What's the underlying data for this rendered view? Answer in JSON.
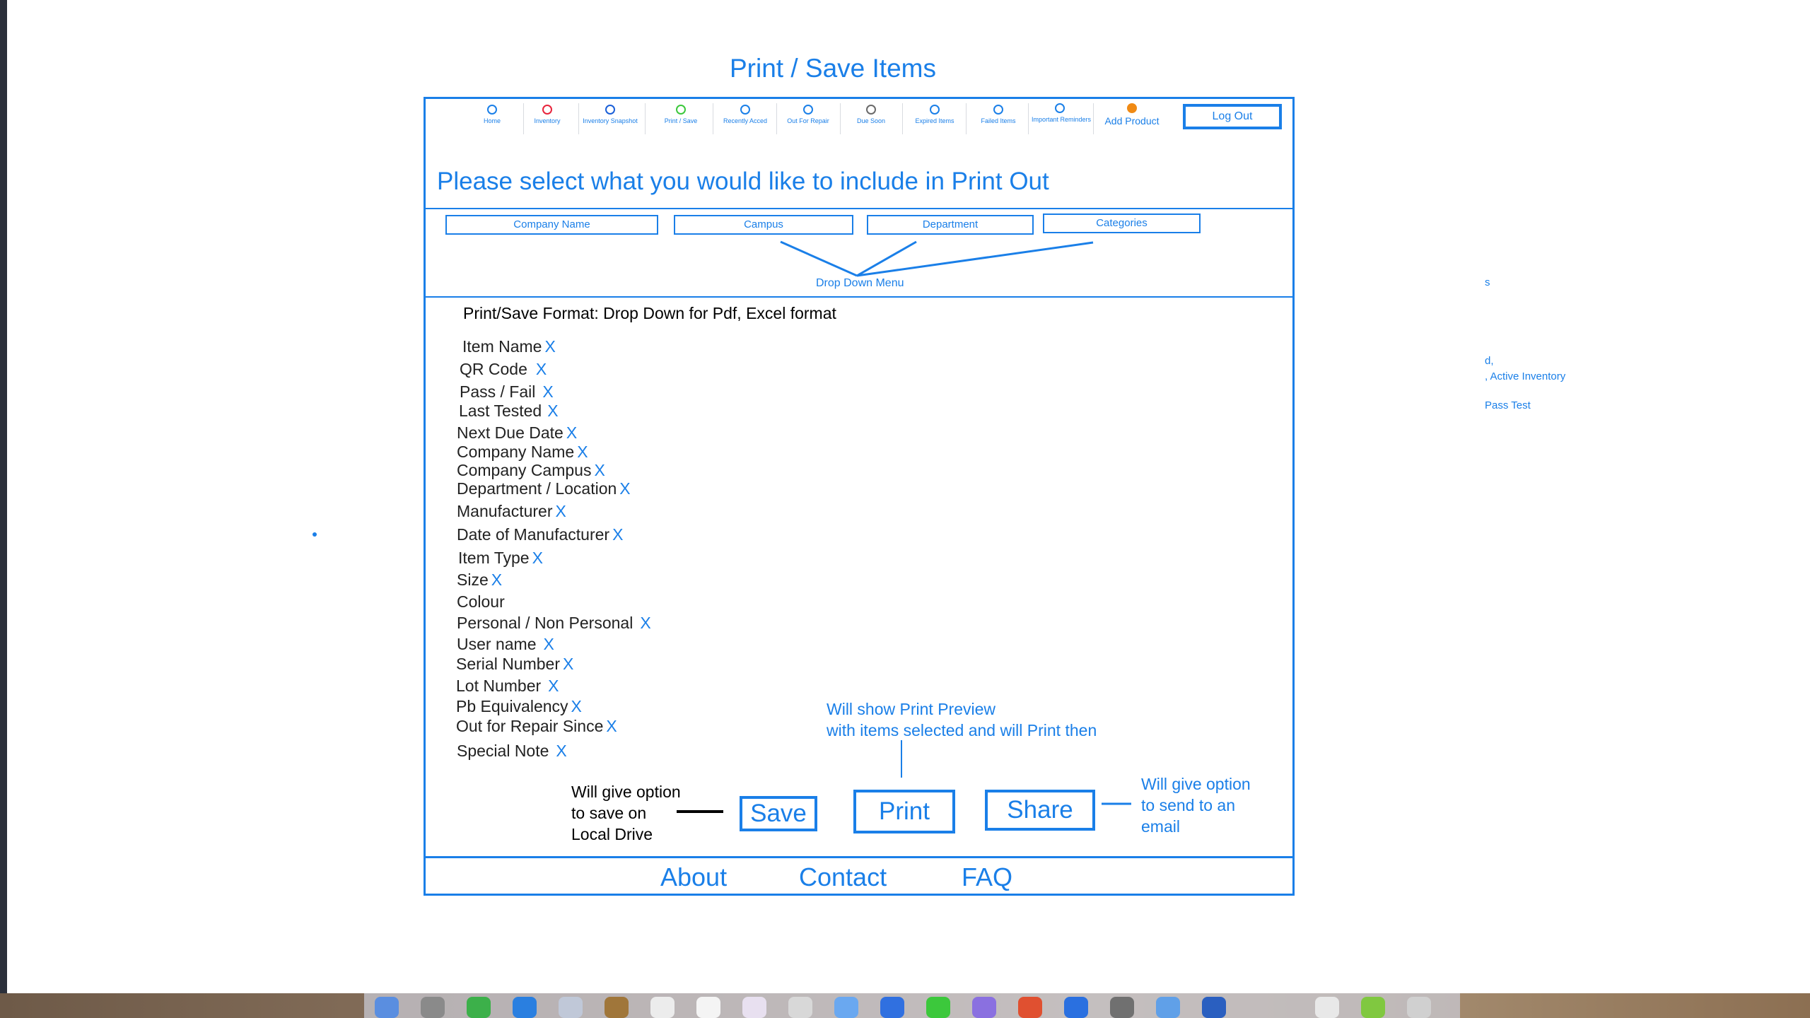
{
  "page_title": "Print / Save Items",
  "nav": {
    "items": [
      {
        "label": "Home",
        "color": "#1a7fe8"
      },
      {
        "label": "Inventory",
        "color": "#e8243c"
      },
      {
        "label": "Inventory Snapshot",
        "color": "#1a5fd8"
      },
      {
        "label": "Print / Save",
        "color": "#3cc83c"
      },
      {
        "label": "Recently Acced",
        "color": "#1a7fe8"
      },
      {
        "label": "Out For Repair",
        "color": "#1a7fe8"
      },
      {
        "label": "Due Soon",
        "color": "#6a6a6a"
      },
      {
        "label": "Expired Items",
        "color": "#1a7fe8"
      },
      {
        "label": "Failed Items",
        "color": "#1a7fe8"
      },
      {
        "label": "Important Reminders",
        "color": "#1a7fe8"
      }
    ],
    "add_product": "Add Product",
    "logout": "Log Out"
  },
  "prompt_title": "Please select what you would like to include in Print Out",
  "filters": {
    "company": "Company Name",
    "campus": "Campus",
    "department": "Department",
    "categories": "Categories",
    "dropdown_label": "Drop Down Menu"
  },
  "format_text": "Print/Save Format: Drop Down for Pdf, Excel format",
  "fields": [
    {
      "label": "Item Name",
      "x": "X"
    },
    {
      "label": "QR Code",
      "x": "X"
    },
    {
      "label": "Pass / Fail",
      "x": "X"
    },
    {
      "label": "Last Tested",
      "x": "X"
    },
    {
      "label": "Next Due Date",
      "x": "X"
    },
    {
      "label": "Company Name",
      "x": "X"
    },
    {
      "label": "Company Campus",
      "x": "X"
    },
    {
      "label": "Department / Location",
      "x": "X"
    },
    {
      "label": "Manufacturer",
      "x": "X"
    },
    {
      "label": "Date of Manufacturer",
      "x": "X"
    },
    {
      "label": "Item Type",
      "x": "X"
    },
    {
      "label": "Size",
      "x": "X"
    },
    {
      "label": "Colour",
      "x": ""
    },
    {
      "label": "Personal / Non Personal",
      "x": "X"
    },
    {
      "label": "User name",
      "x": "X"
    },
    {
      "label": "Serial Number",
      "x": "X"
    },
    {
      "label": "Lot Number",
      "x": "X"
    },
    {
      "label": "Pb Equivalency",
      "x": "X"
    },
    {
      "label": "Out for Repair Since",
      "x": "X"
    },
    {
      "label": "Special Note",
      "x": "X"
    }
  ],
  "actions": {
    "save": "Save",
    "print": "Print",
    "share": "Share"
  },
  "notes": {
    "save_line1": "Will give option",
    "save_line2": "to save on",
    "save_line3": "Local Drive",
    "print_line1": "Will show Print Preview",
    "print_line2": "with items selected  and will Print then",
    "share_line1": "Will give option",
    "share_line2": "to send to an",
    "share_line3": "email"
  },
  "footer": {
    "about": "About",
    "contact": "Contact",
    "faq": "FAQ"
  },
  "side_notes": {
    "s1": "s",
    "s2": "d,",
    "s3": ", Active Inventory",
    "s4": "Pass Test"
  },
  "colors": {
    "accent": "#1a7fe8"
  }
}
